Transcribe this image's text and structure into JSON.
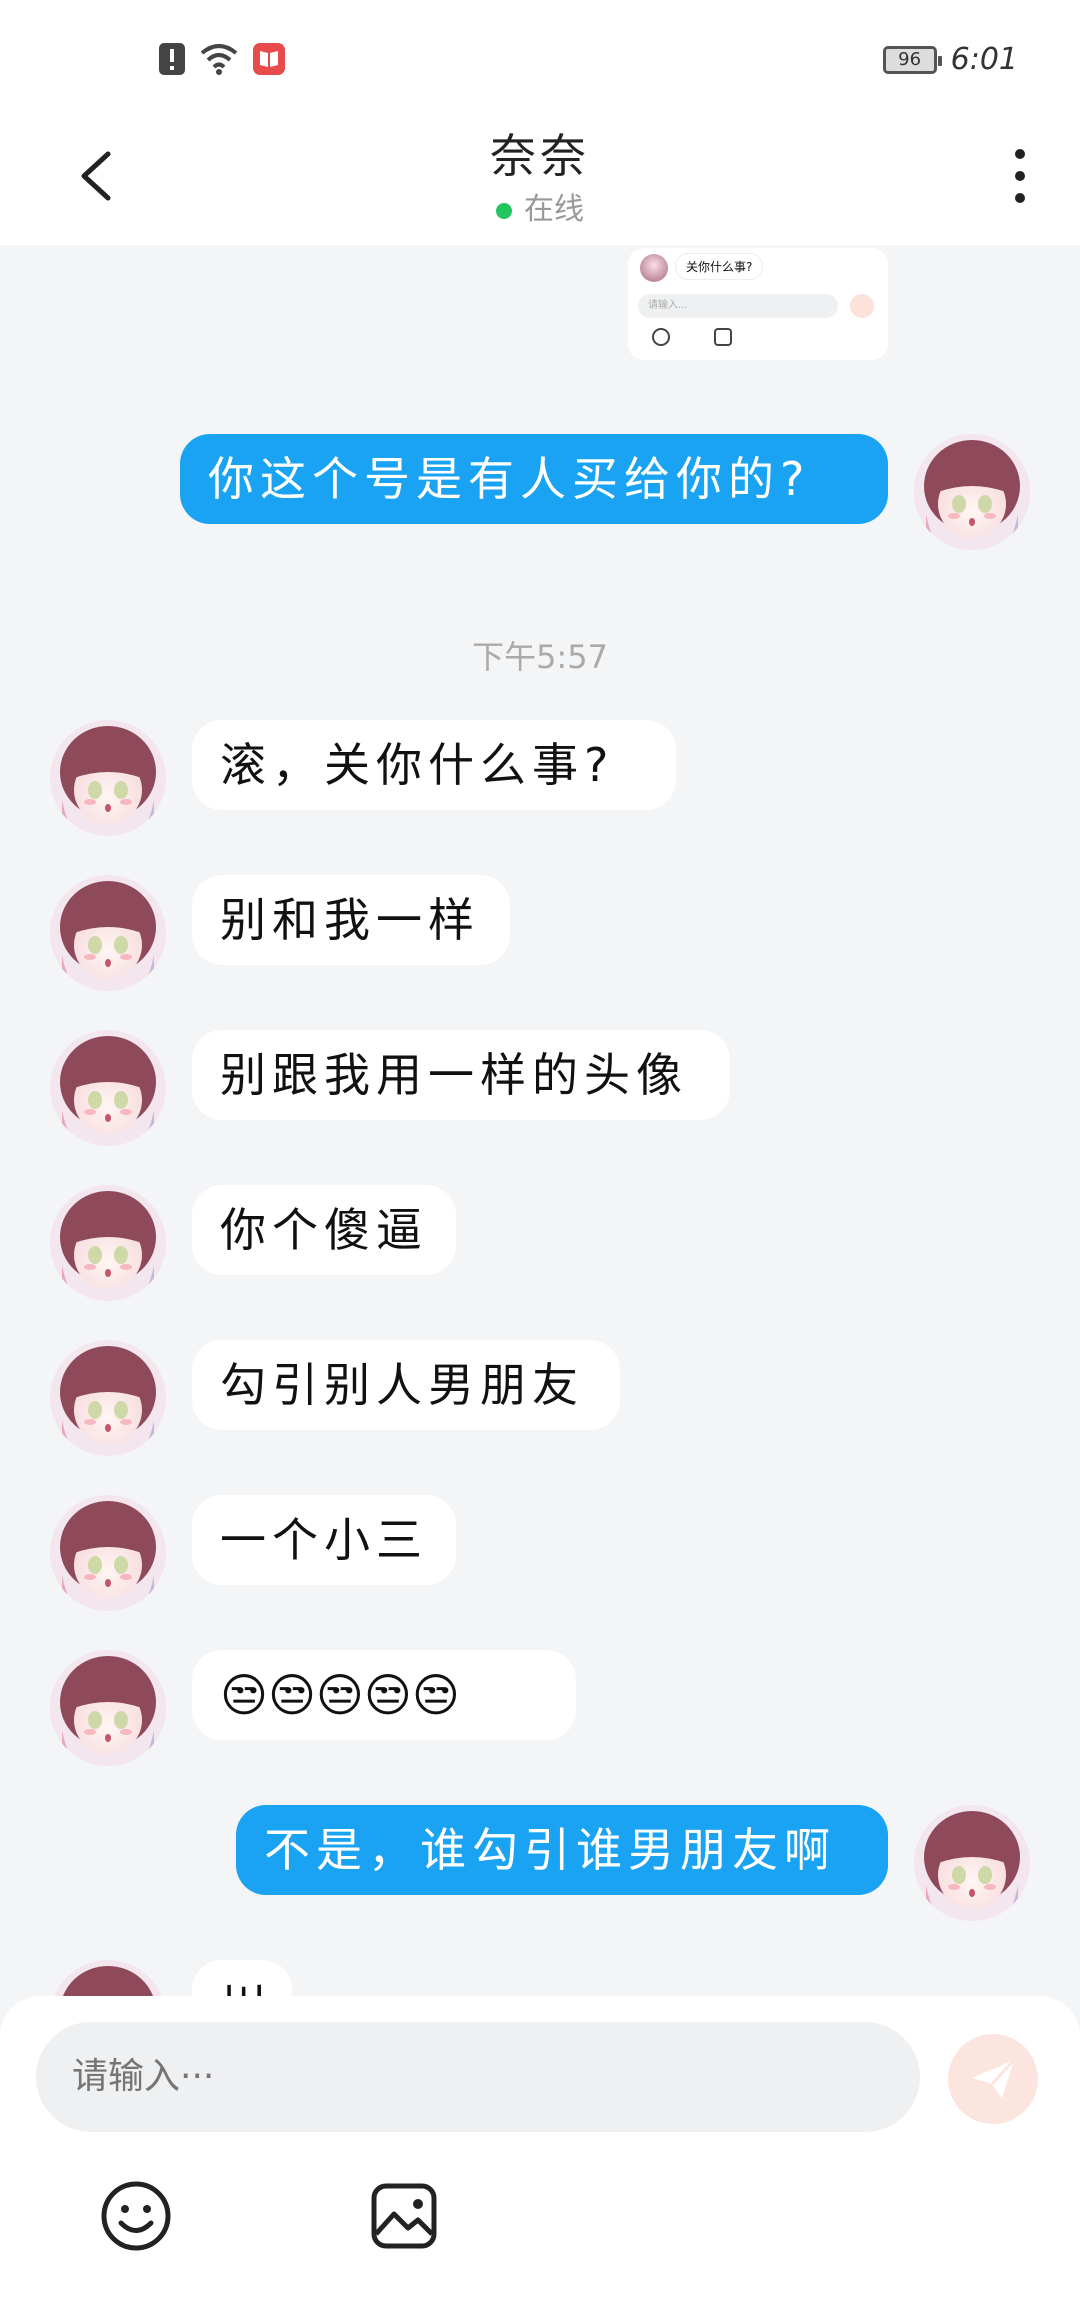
{
  "status_bar": {
    "time": "6:01",
    "battery": "96"
  },
  "header": {
    "title": "奈奈",
    "status": "在线"
  },
  "preview": {
    "bubble": "关你什么事?",
    "placeholder": "请输入..."
  },
  "timestamp": "下午5:57",
  "messages": [
    {
      "side": "out",
      "text": "你这个号是有人买给你的?"
    },
    {
      "side": "in",
      "text": "滚，关你什么事?"
    },
    {
      "side": "in",
      "text": "别和我一样"
    },
    {
      "side": "in",
      "text": "别跟我用一样的头像"
    },
    {
      "side": "in",
      "text": "你个傻逼"
    },
    {
      "side": "in",
      "text": "勾引别人男朋友"
    },
    {
      "side": "in",
      "text": "一个小三"
    },
    {
      "side": "in",
      "text": "😒😒😒😒😒"
    },
    {
      "side": "out",
      "text": "不是，谁勾引谁男朋友啊"
    },
    {
      "side": "in",
      "text": "川"
    }
  ],
  "composer": {
    "placeholder": "请输入···"
  },
  "colors": {
    "outgoing_bubble": "#1aa3f2",
    "online": "#22c55e",
    "send": "#fde5df"
  }
}
